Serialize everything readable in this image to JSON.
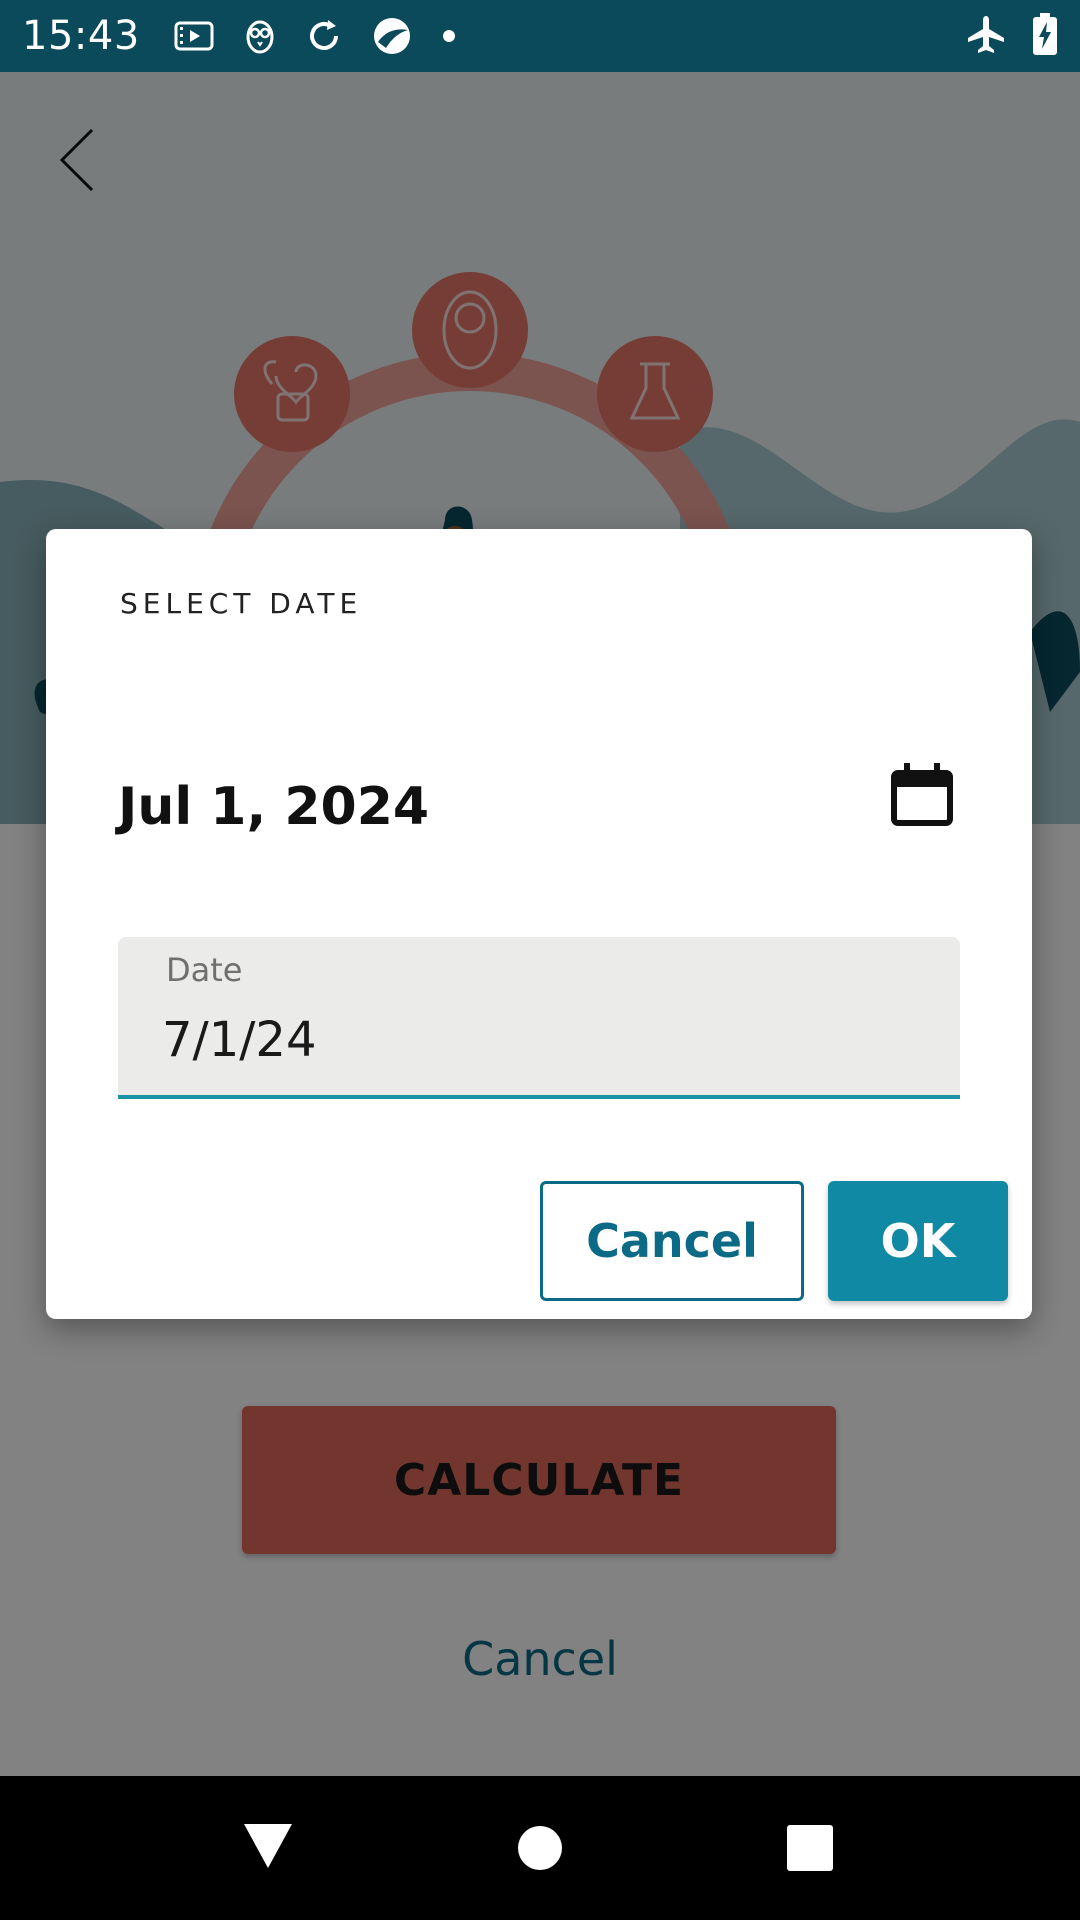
{
  "status_bar": {
    "time": "15:43",
    "icons": [
      "media-icon",
      "owl-icon",
      "sync-icon",
      "app-icon",
      "dot-icon",
      "airplane-icon",
      "battery-charging-icon"
    ]
  },
  "app": {
    "back_icon": "chevron-left-icon",
    "calculate_label": "CALCULATE",
    "cancel_label": "Cancel"
  },
  "dialog": {
    "title": "SELECT DATE",
    "selected_date": "Jul 1, 2024",
    "calendar_icon": "calendar-icon",
    "field": {
      "label": "Date",
      "value": "7/1/24"
    },
    "cancel_label": "Cancel",
    "ok_label": "OK"
  },
  "nav_bar": {
    "icons": [
      "back-triangle-icon",
      "home-circle-icon",
      "recents-square-icon"
    ]
  },
  "colors": {
    "status_bar": "#0b4a5a",
    "accent": "#1089a4",
    "calculate": "#e06a5c",
    "underline": "#1b93a6"
  }
}
